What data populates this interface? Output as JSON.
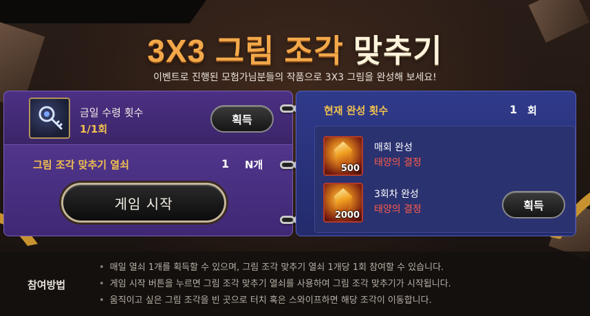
{
  "header": {
    "title_main": "3X3 그림 조각",
    "title_accent": "맞추기",
    "subtitle": "이벤트로 진행된 모험가님분들의 작품으로 3X3 그림을 완성해 보세요!"
  },
  "left_panel": {
    "daily_label": "금일 수령 횟수",
    "daily_value": "1/1회",
    "get_button": "획득",
    "key_label": "그림 조각 맞추기 열쇠",
    "key_count": "1",
    "key_unit": "N개",
    "start_button": "게임 시작"
  },
  "right_panel": {
    "current_label": "현재 완성 횟수",
    "current_count": "1",
    "current_unit": "회",
    "rewards": [
      {
        "title": "매회 완성",
        "item": "태양의 결정",
        "qty": "500"
      },
      {
        "title": "3회차 완성",
        "item": "태양의 결정",
        "qty": "2000"
      }
    ],
    "get_button": "획득"
  },
  "info": {
    "label": "참여방법",
    "items": [
      "매일 열쇠 1개를 획득할 수 있으며, 그림 조각 맞추기 열쇠 1개당 1회 참여할 수 있습니다.",
      "게임 시작 버튼을 누르면 그림 조각 맞추기 열쇠를 사용하여 그림 조각 맞추기가 시작됩니다.",
      "움직이고 싶은 그림 조각을 빈 곳으로 터치 혹은 스와이프하면 해당 조각이 이동합니다."
    ]
  },
  "colors": {
    "gold": "#f2c14e",
    "reward_red": "#ff5b4a",
    "purple_panel": "#4a3284",
    "blue_panel": "#2a3378"
  }
}
